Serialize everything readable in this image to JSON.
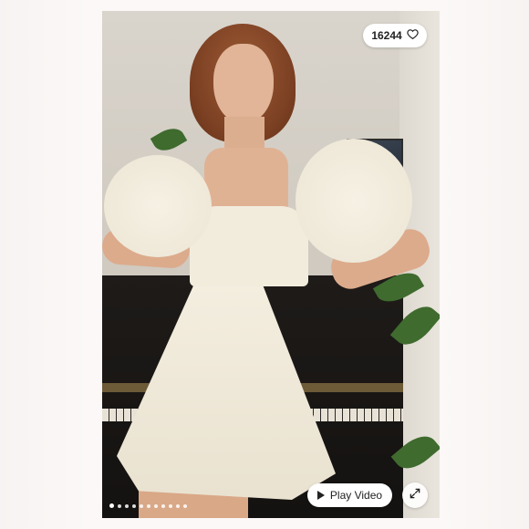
{
  "listing": {
    "like_count": "16244",
    "play_video_label": "Play Video"
  },
  "carousel": {
    "total_dots": 11,
    "active_index": 0
  },
  "icons": {
    "like": "heart-outline-icon",
    "play": "play-icon",
    "expand": "expand-icon"
  },
  "colors": {
    "pill_background": "#ffffff",
    "pill_text": "#222222",
    "page_background": "#fbf8f7"
  }
}
